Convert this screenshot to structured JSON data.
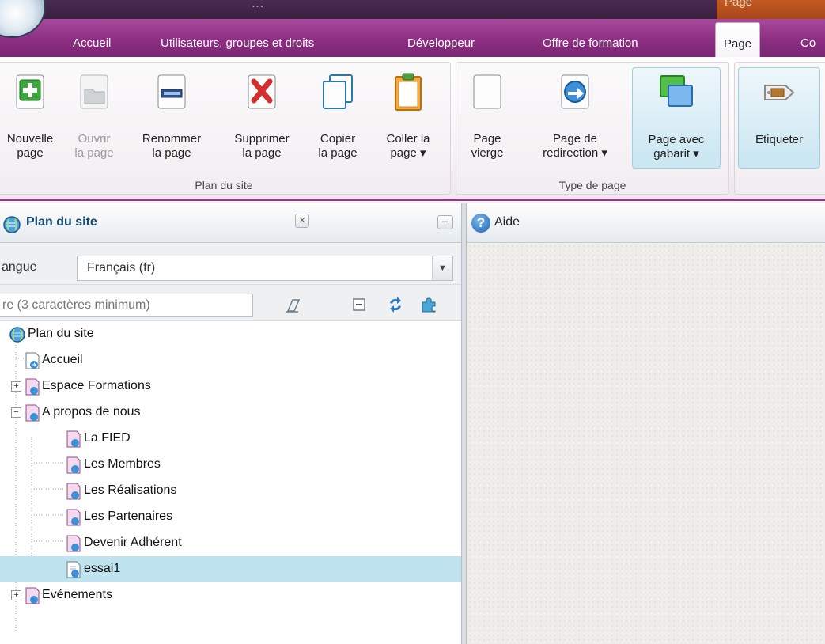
{
  "window": {
    "title": "...",
    "context_tab_group": "Page"
  },
  "ribbon_tabs": [
    {
      "label": "Accueil"
    },
    {
      "label": "Utilisateurs, groupes et droits"
    },
    {
      "label": "Développeur"
    },
    {
      "label": "Offre de formation"
    },
    {
      "label": "Page",
      "active": true
    },
    {
      "label": "Co"
    }
  ],
  "groups": {
    "site_plan": {
      "label": "Plan du site",
      "buttons": [
        {
          "line1": "Nouvelle",
          "line2": "page"
        },
        {
          "line1": "Ouvrir",
          "line2": "la page",
          "disabled": true
        },
        {
          "line1": "Renommer",
          "line2": "la page"
        },
        {
          "line1": "Supprimer",
          "line2": "la page"
        },
        {
          "line1": "Copier",
          "line2": "la page"
        },
        {
          "line1": "Coller la",
          "line2": "page ▾"
        }
      ]
    },
    "page_type": {
      "label": "Type de page",
      "buttons": [
        {
          "line1": "Page",
          "line2": "vierge"
        },
        {
          "line1": "Page de",
          "line2": "redirection ▾"
        },
        {
          "line1": "Page avec",
          "line2": "gabarit ▾"
        }
      ]
    },
    "tag": {
      "buttons": [
        {
          "line1": "Etiqueter",
          "line2": ""
        }
      ]
    }
  },
  "sitemap_panel": {
    "title": "Plan du site",
    "language_label": "angue",
    "language_value": "Français (fr)",
    "filter_placeholder": "re (3 caractères minimum)"
  },
  "help_panel": {
    "title": "Aide"
  },
  "tree": {
    "root": "Plan du site",
    "items": [
      {
        "label": "Accueil"
      },
      {
        "label": "Espace Formations",
        "expander": "+"
      },
      {
        "label": "A propos de nous",
        "expander": "−"
      },
      {
        "label": "La FIED"
      },
      {
        "label": "Les Membres"
      },
      {
        "label": "Les Réalisations"
      },
      {
        "label": "Les Partenaires"
      },
      {
        "label": "Devenir Adhérent"
      },
      {
        "label": "essai1",
        "selected": true
      },
      {
        "label": "Evénements",
        "expander": "+"
      }
    ]
  },
  "colors": {
    "tab_row": "#8c2f82",
    "title_bar": "#3a2040",
    "context_tab": "#c35a20",
    "selected_row": "#bfe3ef",
    "panel_title": "#174a6e"
  },
  "icons": [
    "app-orb-icon",
    "new-page-icon",
    "open-page-icon",
    "rename-page-icon",
    "delete-page-icon",
    "copy-page-icon",
    "paste-page-icon",
    "blank-page-icon",
    "redirect-page-icon",
    "template-page-icon",
    "tag-icon",
    "sitemap-globe-icon",
    "close-icon",
    "pin-icon",
    "help-icon",
    "dropdown-arrow-icon",
    "eraser-icon",
    "collapse-all-icon",
    "refresh-icon",
    "plugin-icon",
    "page-icon"
  ]
}
